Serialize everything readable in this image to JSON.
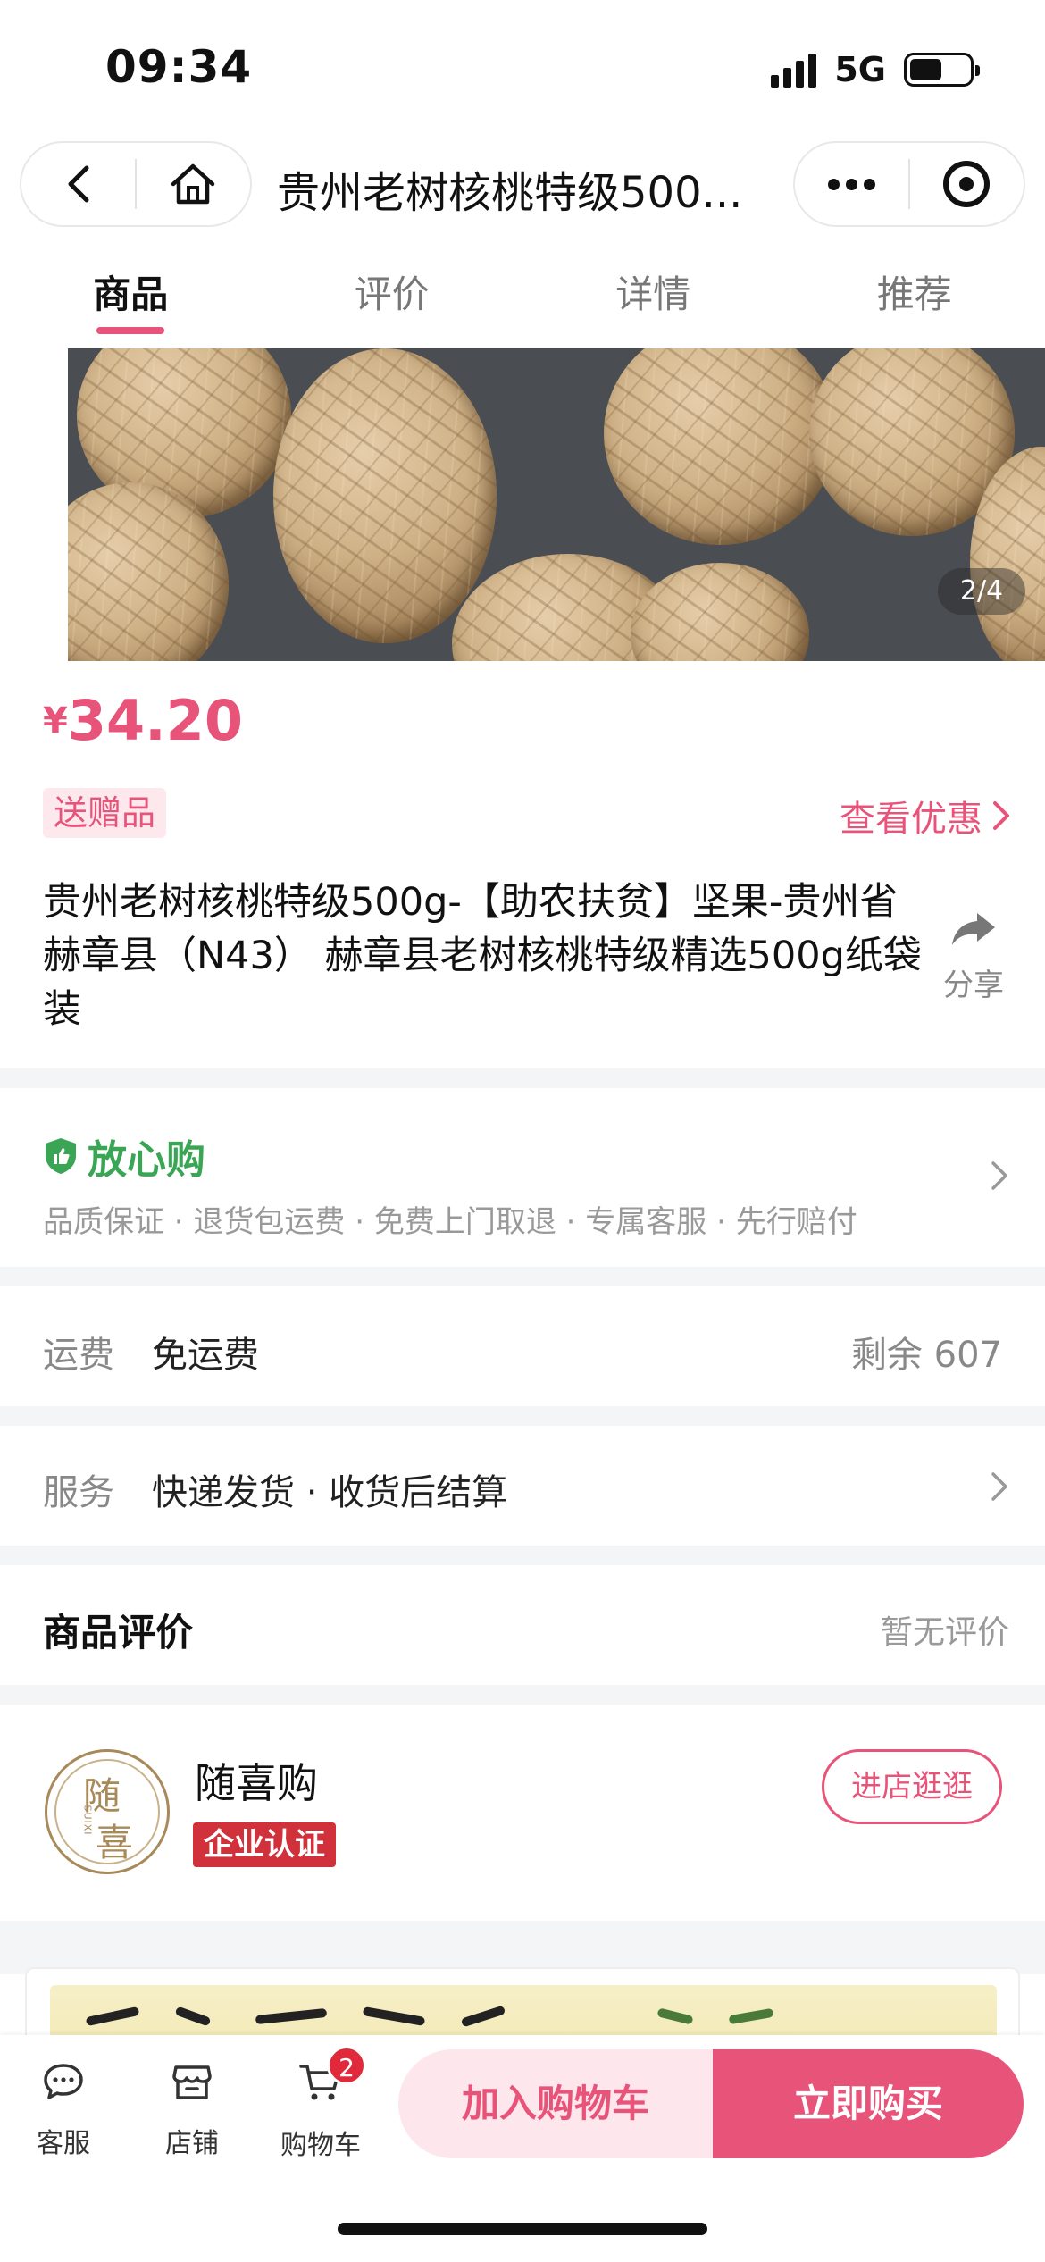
{
  "status_bar": {
    "time": "09:34",
    "network": "5G"
  },
  "nav": {
    "title": "贵州老树核桃特级500..."
  },
  "tabs": [
    {
      "label": "商品",
      "active": true
    },
    {
      "label": "评价",
      "active": false
    },
    {
      "label": "详情",
      "active": false
    },
    {
      "label": "推荐",
      "active": false
    }
  ],
  "gallery": {
    "counter": "2/4"
  },
  "price": {
    "symbol": "¥",
    "value": "34.20"
  },
  "gift_badge": "送赠品",
  "offer_link": "查看优惠",
  "product_name": "贵州老树核桃特级500g-【助农扶贫】坚果-贵州省赫章县（N43） 赫章县老树核桃特级精选500g纸袋装",
  "share_label": "分享",
  "assurance": {
    "title": "放心购",
    "items": "品质保证 · 退货包运费 · 免费上门取退 · 专属客服 · 先行赔付"
  },
  "shipping": {
    "label": "运费",
    "value": "免运费",
    "stock": "剩余 607"
  },
  "service": {
    "label": "服务",
    "value": "快递发货 · 收货后结算"
  },
  "reviews": {
    "title": "商品评价",
    "empty_text": "暂无评价"
  },
  "shop": {
    "logo_char_1": "随",
    "logo_char_2": "喜",
    "logo_small": "SUIXI",
    "name": "随喜购",
    "badge": "企业认证",
    "visit_button": "进店逛逛"
  },
  "bottom_bar": {
    "service_label": "客服",
    "store_label": "店铺",
    "cart_label": "购物车",
    "cart_count": "2",
    "add_to_cart": "加入购物车",
    "buy_now": "立即购买"
  },
  "colors": {
    "accent": "#e8537a",
    "assurance_green": "#3aa655",
    "badge_red": "#d1313a"
  }
}
